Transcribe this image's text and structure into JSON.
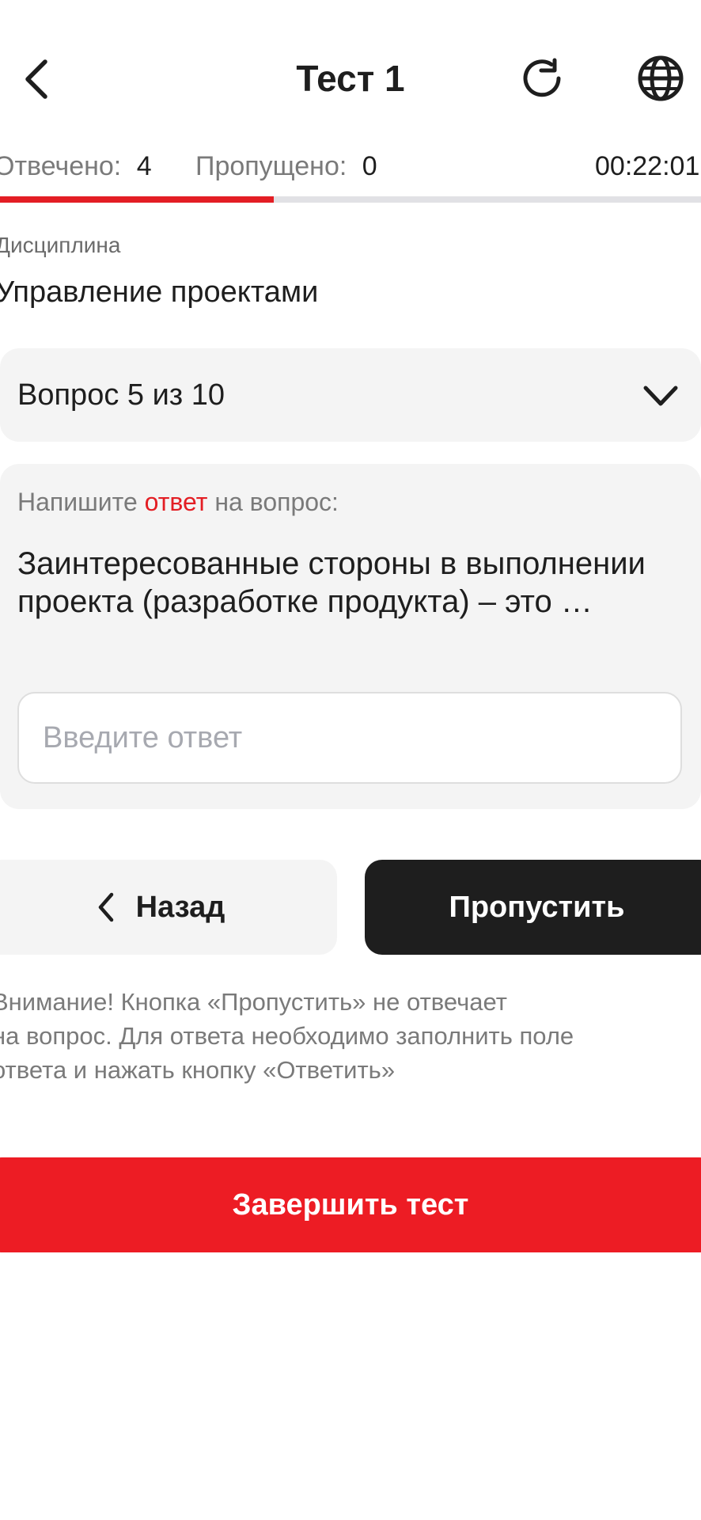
{
  "header": {
    "title": "Тест 1",
    "back_icon": "chevron-left-icon",
    "refresh_icon": "refresh-icon",
    "language_icon": "globe-icon"
  },
  "stats": {
    "answered_label": "Отвечено:",
    "answered_value": "4",
    "skipped_label": "Пропущено:",
    "skipped_value": "0",
    "timer": "00:22:01"
  },
  "progress": {
    "fraction": 0.39
  },
  "discipline": {
    "label": "Дисциплина",
    "value": "Управление проектами"
  },
  "question_select": {
    "label": "Вопрос 5 из 10",
    "icon": "chevron-down-icon"
  },
  "question": {
    "instruction_before": "Напишите ",
    "instruction_accent": "ответ",
    "instruction_after": " на вопрос:",
    "text": "Заинтересованные стороны в выполнении проекта (разработке продукта) – это …",
    "answer_placeholder": "Введите ответ",
    "answer_value": ""
  },
  "nav": {
    "back_label": "Назад",
    "skip_label": "Пропустить"
  },
  "warning": {
    "lines": [
      "Внимание! Кнопка «Пропустить» не отвечает",
      "на вопрос. Для ответа необходимо заполнить поле",
      "ответа и нажать кнопку «Ответить»"
    ]
  },
  "finish": {
    "label": "Завершить тест"
  },
  "colors": {
    "accent": "#e31e24",
    "finish_button": "#ed1c24",
    "dark_button": "#1e1e1e",
    "card_background": "#f4f4f4",
    "muted_text": "#7a7a7a"
  }
}
